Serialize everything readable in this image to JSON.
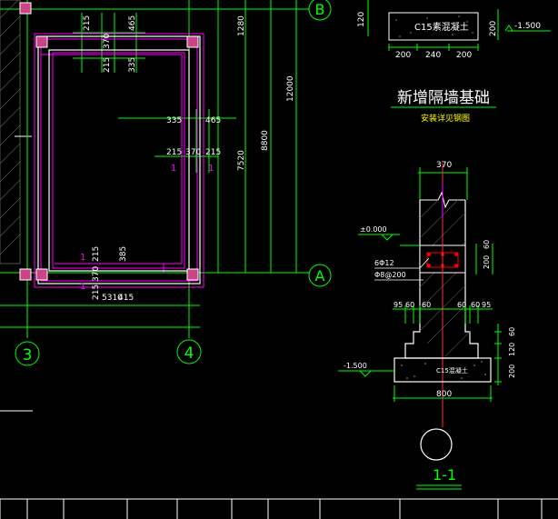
{
  "colors": {
    "background": "#000000",
    "wall": "#ffffff",
    "dimension": "#00ff00",
    "beam": "#ff00ff",
    "axis_circle": "#00ff00",
    "hatch": "#555555",
    "dim_text": "#ffffff",
    "heading": "#ffffff",
    "accent": "#ffff00"
  },
  "grid_labels": {
    "b": "B",
    "a": "A",
    "three": "3",
    "four": "4"
  },
  "plan": {
    "top_dims": [
      "215",
      "370",
      "465"
    ],
    "top_dims2": [
      "215",
      "335"
    ],
    "right_dims_a": [
      "335",
      "465"
    ],
    "right_dims_b": [
      "215",
      "370",
      "215"
    ],
    "bottom_dims": [
      "215",
      "370",
      "385"
    ],
    "bottom_dims2": [
      "215",
      "5310",
      "415"
    ],
    "vertical_dims": [
      "1280",
      "12000",
      "8800",
      "7520"
    ],
    "section_marks": [
      "1",
      "1"
    ],
    "section_marks_bottom": [
      "1",
      "1"
    ]
  },
  "top_right_detail": {
    "label": "C15素混凝土",
    "dims_h": [
      "200",
      "240",
      "200"
    ],
    "dim_v_left": "120",
    "dim_v_right": "200",
    "elevation": "-1.500"
  },
  "title_block": {
    "title": "新增隔墙基础",
    "subtitle": "安装详见钢图"
  },
  "section": {
    "top_width": "370",
    "elevation_top": "±0.000",
    "rebar_label_1": "6Φ12",
    "rebar_label_2": "Φ8@200",
    "beam_height": "200",
    "beam_height2": "60",
    "steps_left": [
      "95",
      "60"
    ],
    "step_mid_left": "60",
    "steps_right": [
      "60",
      "60",
      "95"
    ],
    "right_dims": [
      "60",
      "120",
      "200"
    ],
    "footing_label": "C15混凝土",
    "elevation_bottom": "-1.500",
    "bottom_width": "800",
    "section_name": "1-1"
  }
}
